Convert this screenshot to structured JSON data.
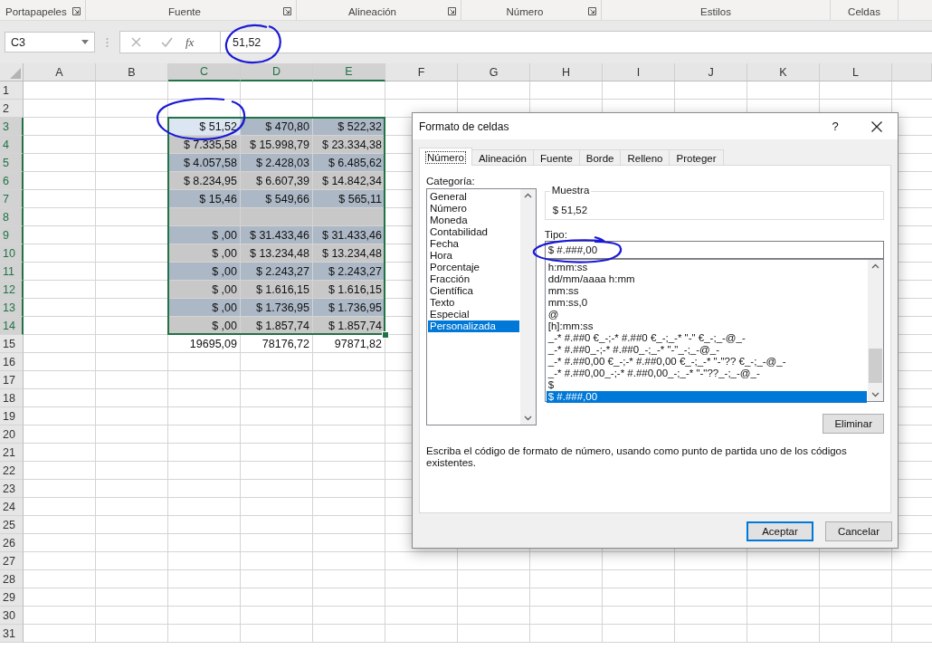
{
  "ribbon_groups": [
    {
      "label": "Portapapeles",
      "launcher": true
    },
    {
      "label": "Fuente",
      "launcher": true
    },
    {
      "label": "Alineación",
      "launcher": true
    },
    {
      "label": "Número",
      "launcher": true
    },
    {
      "label": "Estilos",
      "launcher": false
    },
    {
      "label": "Celdas",
      "launcher": false
    }
  ],
  "formula_bar": {
    "name_box": "C3",
    "function_label": "fx",
    "value": "51,52"
  },
  "sheet": {
    "columns": [
      {
        "label": "A",
        "selected": false
      },
      {
        "label": "B",
        "selected": false
      },
      {
        "label": "C",
        "selected": true
      },
      {
        "label": "D",
        "selected": true
      },
      {
        "label": "E",
        "selected": true
      },
      {
        "label": "F",
        "selected": false
      },
      {
        "label": "G",
        "selected": false
      },
      {
        "label": "H",
        "selected": false
      },
      {
        "label": "I",
        "selected": false
      },
      {
        "label": "J",
        "selected": false
      },
      {
        "label": "K",
        "selected": false
      },
      {
        "label": "L",
        "selected": false
      }
    ],
    "rows": [
      {
        "label": "1",
        "selected": false
      },
      {
        "label": "2",
        "selected": false
      },
      {
        "label": "3",
        "selected": true,
        "color": "#acb8c6",
        "cells": [
          {
            "text": "$ 51,52",
            "active": true
          },
          {
            "text": "$ 470,80",
            "active": false
          },
          {
            "text": "$ 522,32",
            "active": false
          }
        ]
      },
      {
        "label": "4",
        "selected": true,
        "color": "#c8c8c8",
        "cells": [
          {
            "text": "$ 7.335,58",
            "active": false
          },
          {
            "text": "$ 15.998,79",
            "active": false
          },
          {
            "text": "$ 23.334,38",
            "active": false
          }
        ]
      },
      {
        "label": "5",
        "selected": true,
        "color": "#acb8c6",
        "cells": [
          {
            "text": "$ 4.057,58",
            "active": false
          },
          {
            "text": "$ 2.428,03",
            "active": false
          },
          {
            "text": "$ 6.485,62",
            "active": false
          }
        ]
      },
      {
        "label": "6",
        "selected": true,
        "color": "#c8c8c8",
        "cells": [
          {
            "text": "$ 8.234,95",
            "active": false
          },
          {
            "text": "$ 6.607,39",
            "active": false
          },
          {
            "text": "$ 14.842,34",
            "active": false
          }
        ]
      },
      {
        "label": "7",
        "selected": true,
        "color": "#acb8c6",
        "cells": [
          {
            "text": "$ 15,46",
            "active": false
          },
          {
            "text": "$ 549,66",
            "active": false
          },
          {
            "text": "$ 565,11",
            "active": false
          }
        ]
      },
      {
        "label": "8",
        "selected": true,
        "color": "#c8c8c8"
      },
      {
        "label": "9",
        "selected": true,
        "color": "#acb8c6",
        "cells": [
          {
            "text": "$ ,00",
            "active": false
          },
          {
            "text": "$ 31.433,46",
            "active": false
          },
          {
            "text": "$ 31.433,46",
            "active": false
          }
        ]
      },
      {
        "label": "10",
        "selected": true,
        "color": "#c8c8c8",
        "cells": [
          {
            "text": "$ ,00",
            "active": false
          },
          {
            "text": "$ 13.234,48",
            "active": false
          },
          {
            "text": "$ 13.234,48",
            "active": false
          }
        ]
      },
      {
        "label": "11",
        "selected": true,
        "color": "#acb8c6",
        "cells": [
          {
            "text": "$ ,00",
            "active": false
          },
          {
            "text": "$ 2.243,27",
            "active": false
          },
          {
            "text": "$ 2.243,27",
            "active": false
          }
        ]
      },
      {
        "label": "12",
        "selected": true,
        "color": "#c8c8c8",
        "cells": [
          {
            "text": "$ ,00",
            "active": false
          },
          {
            "text": "$ 1.616,15",
            "active": false
          },
          {
            "text": "$ 1.616,15",
            "active": false
          }
        ]
      },
      {
        "label": "13",
        "selected": true,
        "color": "#acb8c6",
        "cells": [
          {
            "text": "$ ,00",
            "active": false
          },
          {
            "text": "$ 1.736,95",
            "active": false
          },
          {
            "text": "$ 1.736,95",
            "active": false
          }
        ]
      },
      {
        "label": "14",
        "selected": true,
        "color": "#c8c8c8",
        "cells": [
          {
            "text": "$ ,00",
            "active": false
          },
          {
            "text": "$ 1.857,74",
            "active": false
          },
          {
            "text": "$ 1.857,74",
            "active": false
          }
        ]
      },
      {
        "label": "15",
        "selected": false,
        "cells": [
          {
            "text": "19695,09",
            "active": false
          },
          {
            "text": "78176,72",
            "active": false
          },
          {
            "text": "97871,82",
            "active": false
          }
        ]
      },
      {
        "label": "16",
        "selected": false
      },
      {
        "label": "17",
        "selected": false
      },
      {
        "label": "18",
        "selected": false
      },
      {
        "label": "19",
        "selected": false
      },
      {
        "label": "20",
        "selected": false
      },
      {
        "label": "21",
        "selected": false
      },
      {
        "label": "22",
        "selected": false
      },
      {
        "label": "23",
        "selected": false
      },
      {
        "label": "24",
        "selected": false
      },
      {
        "label": "25",
        "selected": false
      },
      {
        "label": "26",
        "selected": false
      },
      {
        "label": "27",
        "selected": false
      },
      {
        "label": "28",
        "selected": false
      },
      {
        "label": "29",
        "selected": false
      },
      {
        "label": "30",
        "selected": false
      },
      {
        "label": "31",
        "selected": false
      }
    ]
  },
  "dialog": {
    "title": "Formato de celdas",
    "help": "?",
    "tabs": [
      {
        "label": "Número",
        "selected": true
      },
      {
        "label": "Alineación",
        "selected": false
      },
      {
        "label": "Fuente",
        "selected": false
      },
      {
        "label": "Borde",
        "selected": false
      },
      {
        "label": "Relleno",
        "selected": false
      },
      {
        "label": "Proteger",
        "selected": false
      }
    ],
    "category_label": "Categoría:",
    "categories": [
      {
        "label": "General",
        "selected": false
      },
      {
        "label": "Número",
        "selected": false
      },
      {
        "label": "Moneda",
        "selected": false
      },
      {
        "label": "Contabilidad",
        "selected": false
      },
      {
        "label": "Fecha",
        "selected": false
      },
      {
        "label": "Hora",
        "selected": false
      },
      {
        "label": "Porcentaje",
        "selected": false
      },
      {
        "label": "Fracción",
        "selected": false
      },
      {
        "label": "Científica",
        "selected": false
      },
      {
        "label": "Texto",
        "selected": false
      },
      {
        "label": "Especial",
        "selected": false
      },
      {
        "label": "Personalizada",
        "selected": true
      }
    ],
    "sample_label": "Muestra",
    "sample_value": "$ 51,52",
    "type_label": "Tipo:",
    "type_value": "$ #.###,00",
    "types": [
      {
        "label": "h:mm:ss",
        "selected": false
      },
      {
        "label": "dd/mm/aaaa h:mm",
        "selected": false
      },
      {
        "label": "mm:ss",
        "selected": false
      },
      {
        "label": "mm:ss,0",
        "selected": false
      },
      {
        "label": "@",
        "selected": false
      },
      {
        "label": "[h]:mm:ss",
        "selected": false
      },
      {
        "label": "_-* #.##0 €_-;-* #.##0 €_-;_-* \"-\" €_-;_-@_-",
        "selected": false
      },
      {
        "label": "_-* #.##0_-;-* #.##0_-;_-* \"-\"_-;_-@_-",
        "selected": false
      },
      {
        "label": "_-* #.##0,00 €_-;-* #.##0,00 €_-;_-* \"-\"?? €_-;_-@_-",
        "selected": false
      },
      {
        "label": "_-* #.##0,00_-;-* #.##0,00_-;_-* \"-\"??_-;_-@_-",
        "selected": false
      },
      {
        "label": "$",
        "selected": false
      },
      {
        "label": "$ #.###,00",
        "selected": true
      }
    ],
    "delete_button": "Eliminar",
    "description": "Escriba el código de formato de número, usando como punto de partida uno de los códigos existentes.",
    "buttons": [
      {
        "label": "Aceptar",
        "default": true
      },
      {
        "label": "Cancelar",
        "default": false
      }
    ]
  }
}
